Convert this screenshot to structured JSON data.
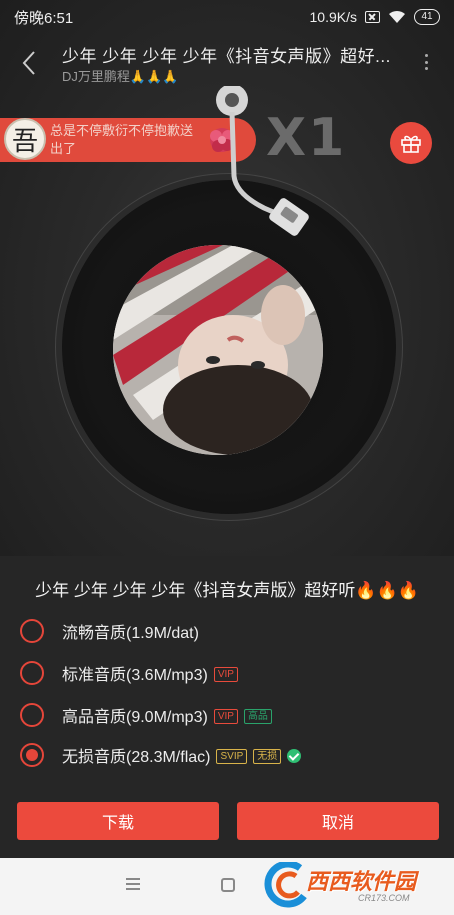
{
  "status_bar": {
    "time": "傍晚6:51",
    "network_speed": "10.9K/s",
    "battery": "41"
  },
  "header": {
    "title": "少年 少年 少年 少年《抖音女声版》超好...",
    "artist": "DJ万里鹏程🙏🙏🙏"
  },
  "danmu": {
    "avatar_char": "吾",
    "text": "总是不停敷衍不停抱歉送出了"
  },
  "gift_multiplier": "X1",
  "sheet": {
    "title": "少年 少年 少年 少年《抖音女声版》超好听🔥🔥🔥",
    "options": [
      {
        "label": "流畅音质(1.9M/dat)",
        "tags": []
      },
      {
        "label": "标准音质(3.6M/mp3)",
        "tags": [
          "VIP"
        ]
      },
      {
        "label": "高品音质(9.0M/mp3)",
        "tags": [
          "VIP",
          "高品"
        ]
      },
      {
        "label": "无损音质(28.3M/flac)",
        "tags": [
          "SVIP",
          "无损"
        ]
      }
    ],
    "selected_index": 3,
    "download_label": "下载",
    "cancel_label": "取消"
  },
  "watermark": {
    "text": "西西软件园",
    "url": "CR173.COM"
  },
  "colors": {
    "accent": "#ec4a3d",
    "sheet_bg": "#262626",
    "vip_tag": "#e84b3c",
    "gaopin_tag": "#2aa36b",
    "svip_tag": "#d8b34a",
    "check": "#2fbf73"
  }
}
